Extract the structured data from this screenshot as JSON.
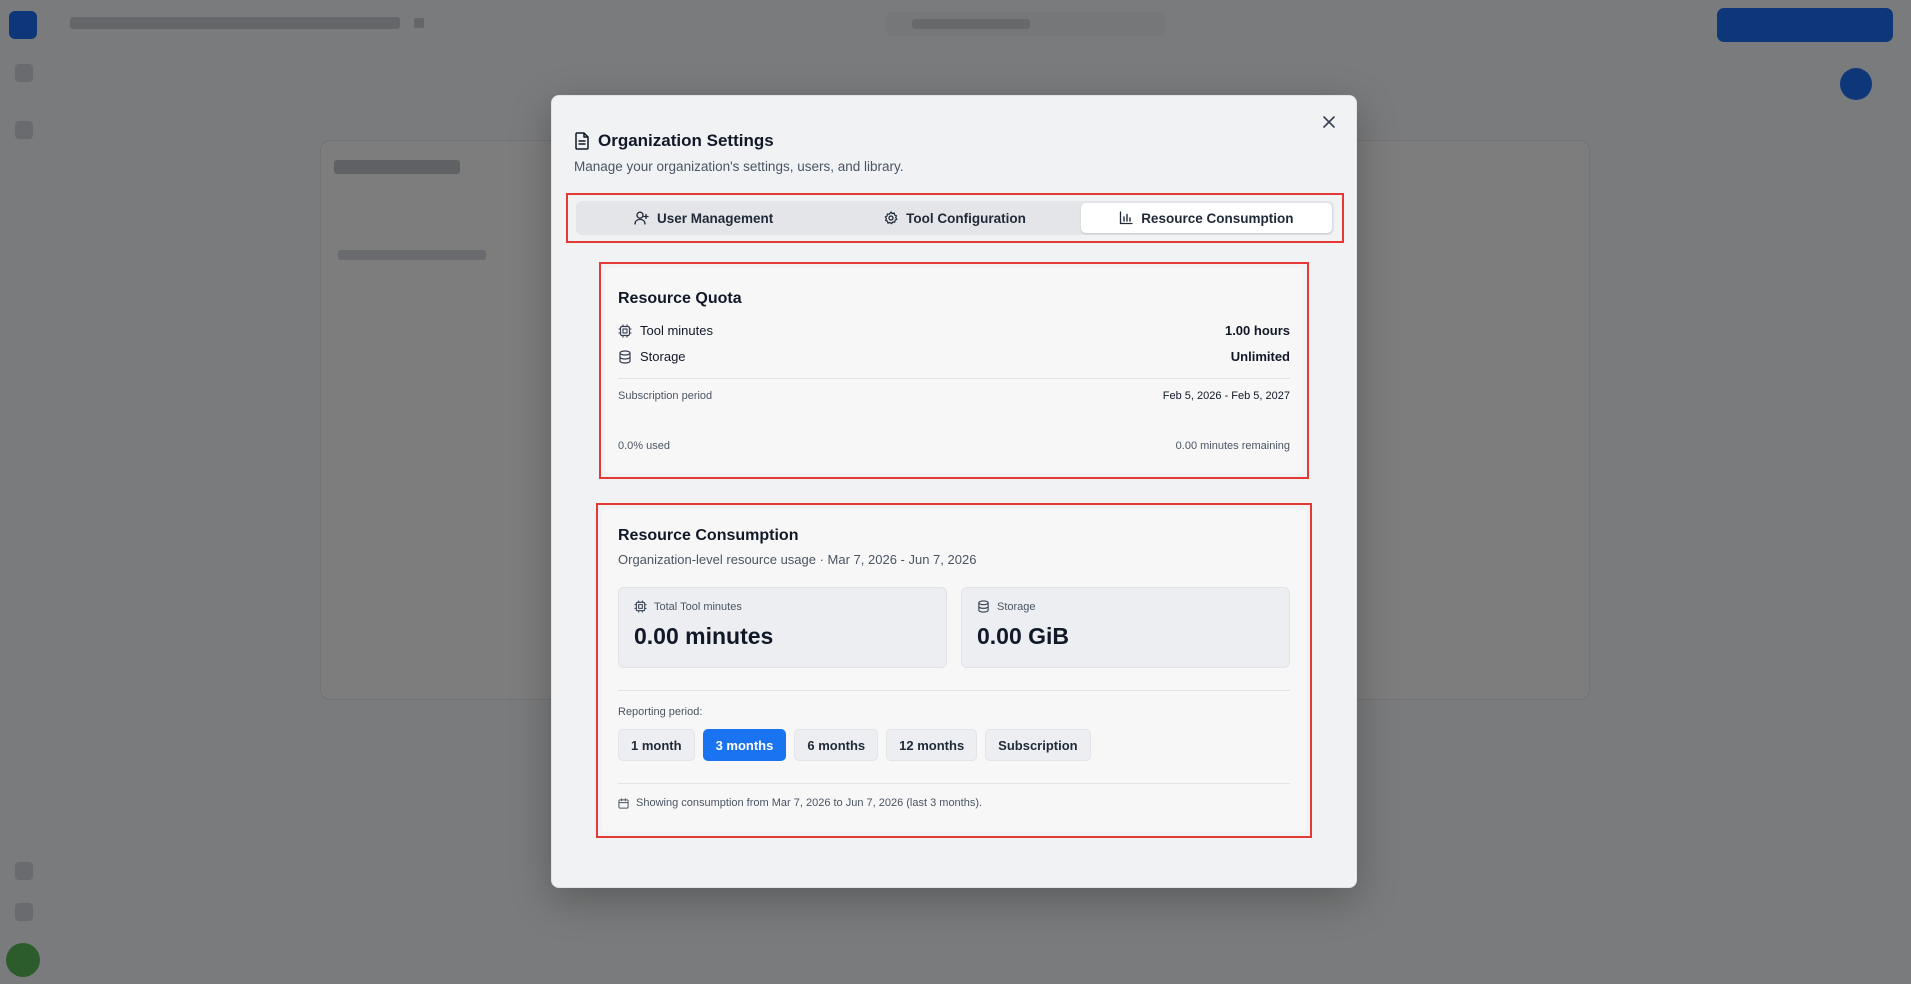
{
  "modal": {
    "title": "Organization Settings",
    "subtitle": "Manage your organization's settings, users, and library."
  },
  "tabs": [
    {
      "label": "User Management",
      "icon": "user-plus-icon",
      "active": false
    },
    {
      "label": "Tool Configuration",
      "icon": "gear-icon",
      "active": false
    },
    {
      "label": "Resource Consumption",
      "icon": "bar-chart-icon",
      "active": true
    }
  ],
  "quota": {
    "title": "Resource Quota",
    "tool_minutes_label": "Tool minutes",
    "tool_minutes_value": "1.00 hours",
    "storage_label": "Storage",
    "storage_value": "Unlimited",
    "subscription_label": "Subscription period",
    "subscription_value": "Feb 5, 2026 - Feb 5, 2027",
    "used": "0.0% used",
    "remaining": "0.00 minutes remaining",
    "used_fraction": 0.0
  },
  "consumption": {
    "title": "Resource Consumption",
    "subtitle": "Organization-level resource usage · Mar 7, 2026 - Jun 7, 2026",
    "total_tool_label": "Total Tool minutes",
    "total_tool_value": "0.00 minutes",
    "storage_label": "Storage",
    "storage_value": "0.00 GiB",
    "period_label": "Reporting period:",
    "periods": [
      {
        "label": "1 month",
        "active": false
      },
      {
        "label": "3 months",
        "active": true
      },
      {
        "label": "6 months",
        "active": false
      },
      {
        "label": "12 months",
        "active": false
      },
      {
        "label": "Subscription",
        "active": false
      }
    ],
    "showing": "Showing consumption from Mar 7, 2026 to Jun 7, 2026 (last 3 months)."
  },
  "colors": {
    "accent": "#1a73f0",
    "highlight": "#e53935"
  }
}
